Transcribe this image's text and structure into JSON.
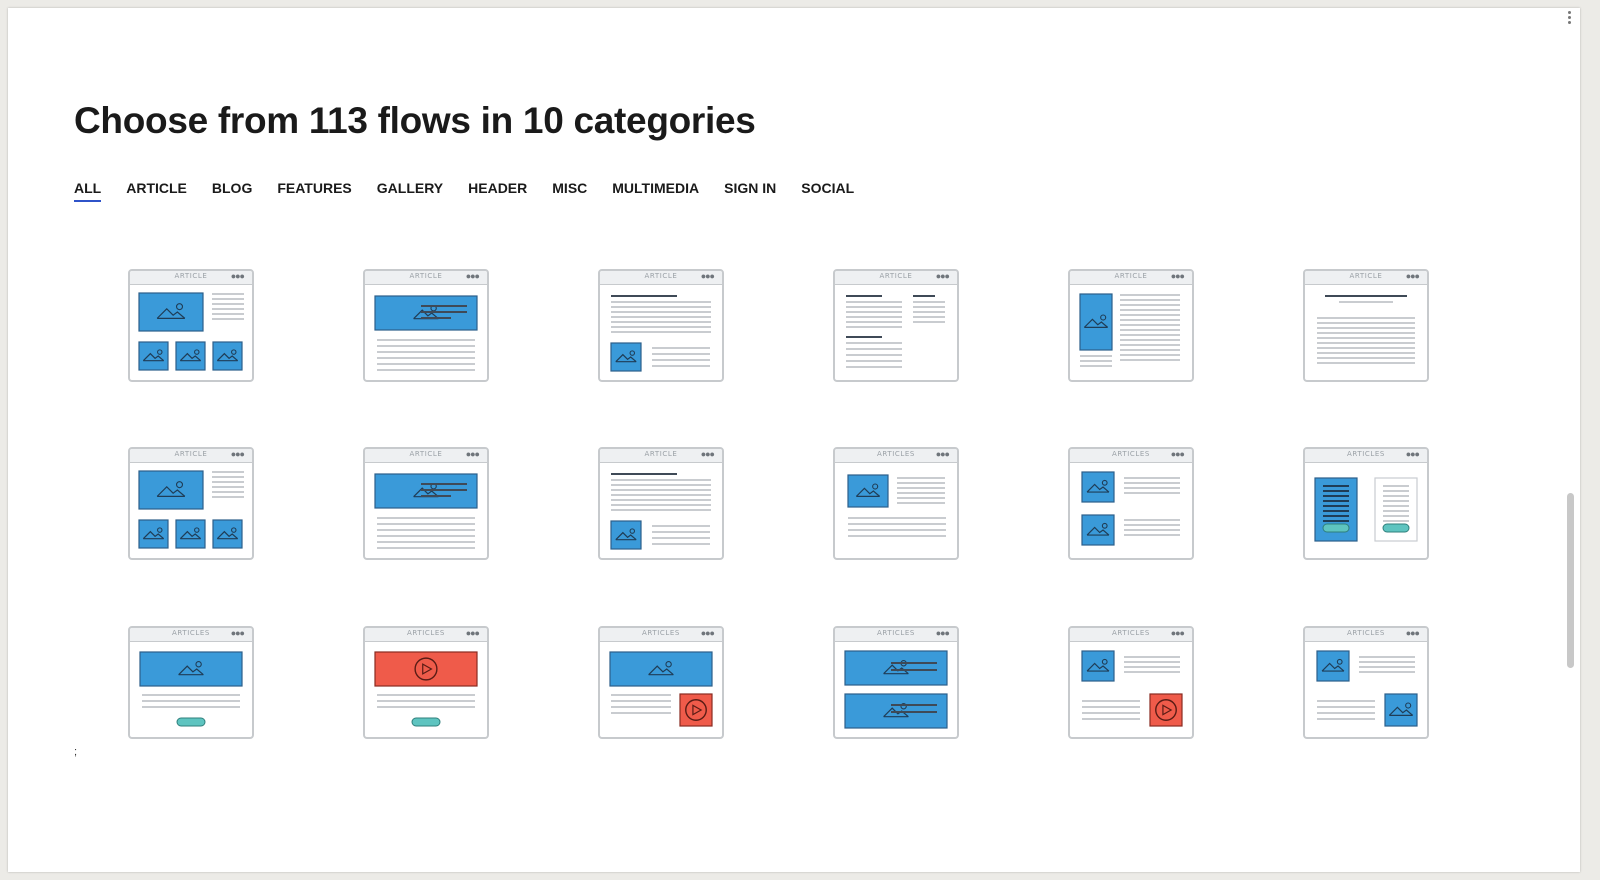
{
  "heading": "Choose from 113 flows in 10 categories",
  "tabs": [
    "ALL",
    "ARTICLE",
    "BLOG",
    "FEATURES",
    "GALLERY",
    "HEADER",
    "MISC",
    "MULTIMEDIA",
    "SIGN IN",
    "SOCIAL"
  ],
  "active_tab": "ALL",
  "stray_text": ";",
  "colors": {
    "blue": "#3a9ad9",
    "blue_stroke": "#2c5f8a",
    "red": "#ef5b4a",
    "teal": "#5ec4c0",
    "line": "#c9ccd0",
    "dark_line": "#3f4a57"
  },
  "cards": [
    {
      "label": "ARTICLE",
      "layout": "big-image-three-thumbs"
    },
    {
      "label": "ARTICLE",
      "layout": "banner-image-text"
    },
    {
      "label": "ARTICLE",
      "layout": "text-then-thumb"
    },
    {
      "label": "ARTICLE",
      "layout": "text-columns"
    },
    {
      "label": "ARTICLE",
      "layout": "tall-image-text"
    },
    {
      "label": "ARTICLE",
      "layout": "centered-text"
    },
    {
      "label": "ARTICLE",
      "layout": "big-image-three-thumbs"
    },
    {
      "label": "ARTICLE",
      "layout": "banner-image-text"
    },
    {
      "label": "ARTICLE",
      "layout": "text-then-thumb"
    },
    {
      "label": "ARTICLES",
      "layout": "thumb-text-lines"
    },
    {
      "label": "ARTICLES",
      "layout": "two-thumbs-text"
    },
    {
      "label": "ARTICLES",
      "layout": "two-columns-buttons"
    },
    {
      "label": "ARTICLES",
      "layout": "banner-button"
    },
    {
      "label": "ARTICLES",
      "layout": "video-banner-button"
    },
    {
      "label": "ARTICLES",
      "layout": "banner-video-thumb"
    },
    {
      "label": "ARTICLES",
      "layout": "two-banners"
    },
    {
      "label": "ARTICLES",
      "layout": "thumb-video-thumb"
    },
    {
      "label": "ARTICLES",
      "layout": "thumb-image-thumb"
    }
  ]
}
